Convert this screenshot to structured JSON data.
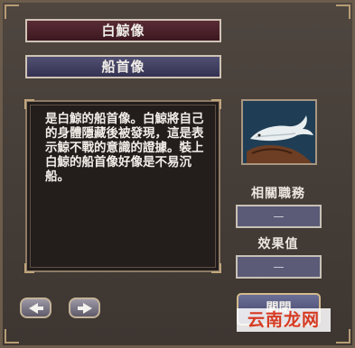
{
  "item": {
    "name": "白鯨像",
    "category": "船首像",
    "description": "是白鯨的船首像。白鯨將自己的身體隱藏後被發現，這是表示鯨不戰的意識的證據。裝上白鯨的船首像好像是不易沉船。",
    "portrait_icon": "white-whale-figurehead-icon"
  },
  "fields": {
    "role_label": "相關職務",
    "role_value": "—",
    "effect_label": "效果值",
    "effect_value": "—"
  },
  "buttons": {
    "prev_icon": "left-arrow-icon",
    "next_icon": "right-arrow-icon",
    "close_label": "關閉"
  },
  "watermark": {
    "text": "云南龙网"
  },
  "colors": {
    "name_bar": "#4a2129",
    "sub_bar": "#42415f",
    "panel_bg": "#463e38",
    "frame": "#b79c74",
    "watermark_text": "#d63b22"
  }
}
